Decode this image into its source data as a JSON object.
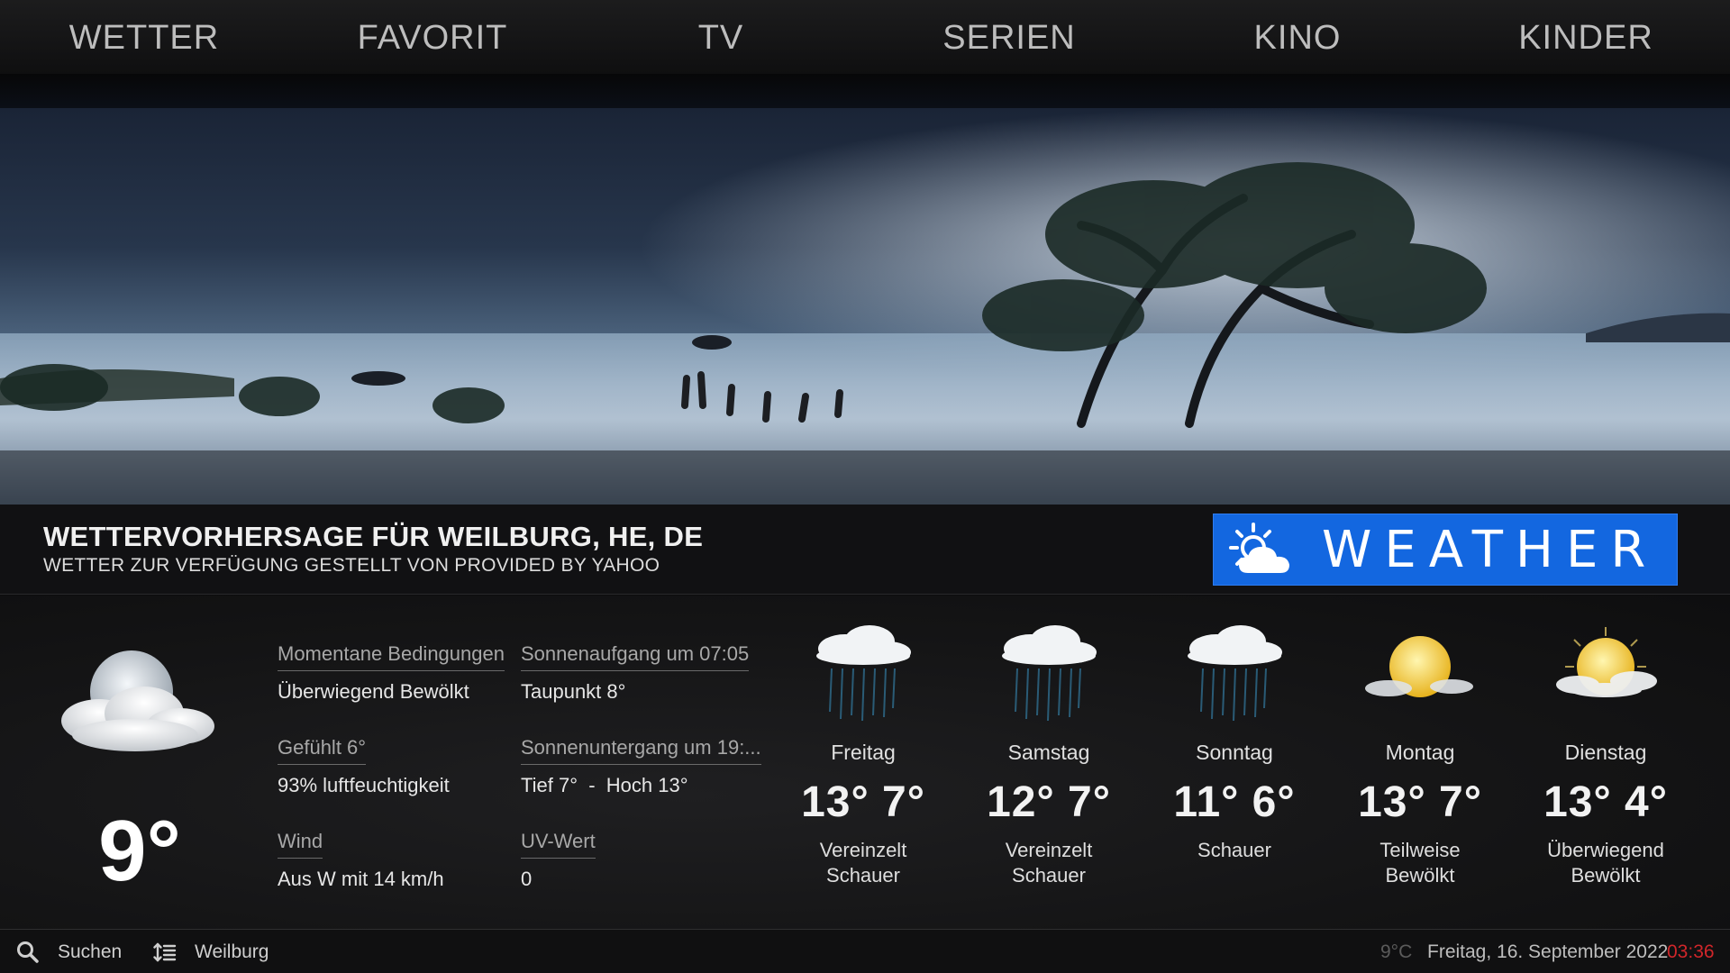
{
  "nav": {
    "items": [
      "WETTER",
      "FAVORIT",
      "TV",
      "SERIEN",
      "KINO",
      "KINDER"
    ]
  },
  "header": {
    "title": "WETTERVORHERSAGE FÜR WEILBURG, HE, DE",
    "subtitle": "WETTER ZUR VERFÜGUNG GESTELLT VON PROVIDED BY YAHOO",
    "logo_text": "WEATHER",
    "logo_icon": "partly-cloudy-day-icon",
    "logo_color": "#1367e0"
  },
  "current": {
    "icon": "cloudy-moon-icon",
    "temperature": "9°",
    "details": {
      "conditions_label": "Momentane Bedingungen",
      "conditions_value": "Überwiegend Bewölkt",
      "feels_label": "Gefühlt 6°",
      "humidity_value": "93% luftfeuchtigkeit",
      "wind_label": "Wind",
      "wind_value": "Aus W mit 14 km/h",
      "sunrise_label": "Sonnenaufgang um 07:05",
      "dewpoint_value": "Taupunkt 8°",
      "sunset_label": "Sonnenuntergang um 19:...",
      "lowhigh_value": "Tief 7°  -  Hoch 13°",
      "uv_label": "UV-Wert",
      "uv_value": "0"
    }
  },
  "forecast": [
    {
      "day": "Freitag",
      "temps": "13° 7°",
      "condition_line1": "Vereinzelt",
      "condition_line2": "Schauer",
      "icon": "rain-cloud-icon"
    },
    {
      "day": "Samstag",
      "temps": "12° 7°",
      "condition_line1": "Vereinzelt",
      "condition_line2": "Schauer",
      "icon": "rain-cloud-icon"
    },
    {
      "day": "Sonntag",
      "temps": "11° 6°",
      "condition_line1": "Schauer",
      "condition_line2": "",
      "icon": "rain-cloud-icon"
    },
    {
      "day": "Montag",
      "temps": "13° 7°",
      "condition_line1": "Teilweise",
      "condition_line2": "Bewölkt",
      "icon": "sun-cloud-icon"
    },
    {
      "day": "Dienstag",
      "temps": "13° 4°",
      "condition_line1": "Überwiegend",
      "condition_line2": "Bewölkt",
      "icon": "sun-cloud-icon"
    }
  ],
  "statusbar": {
    "search_label": "Suchen",
    "search_icon": "search-icon",
    "location_icon": "sort-list-icon",
    "location_label": "Weilburg",
    "temperature": "9°C",
    "date": "Freitag, 16. September 2022",
    "time": "03:36",
    "time_color": "#d0262a"
  }
}
